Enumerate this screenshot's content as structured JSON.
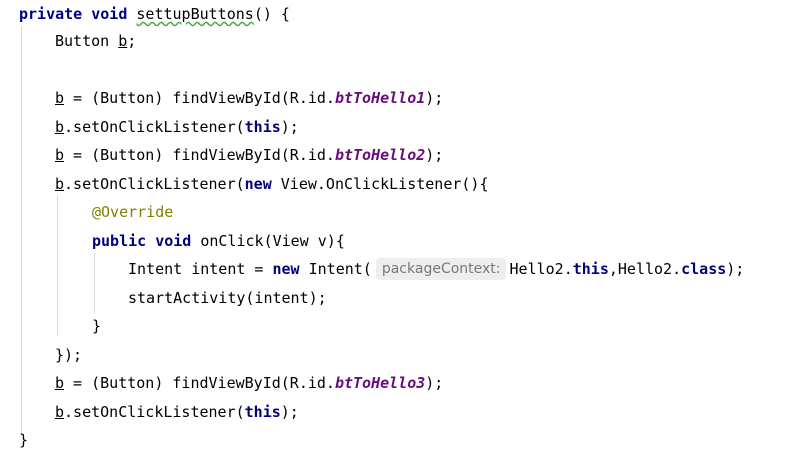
{
  "code": {
    "l1": {
      "kw_private": "private",
      "kw_void": "void",
      "method": "settupButtons",
      "rest": "() {"
    },
    "l2": {
      "type": "Button",
      "var": "b",
      "semi": ";"
    },
    "l4": {
      "var": "b",
      "assign": " = (Button) findViewById(R.id.",
      "field": "btToHello1",
      "end": ");"
    },
    "l5": {
      "var": "b",
      "call": ".setOnClickListener(",
      "kw_this": "this",
      "end": ");"
    },
    "l6": {
      "var": "b",
      "assign": " = (Button) findViewById(R.id.",
      "field": "btToHello2",
      "end": ");"
    },
    "l7": {
      "var": "b",
      "call": ".setOnClickListener(",
      "kw_new": "new",
      "rest": " View.OnClickListener(){"
    },
    "l8": {
      "annotation": "@Override"
    },
    "l9": {
      "kw_public": "public",
      "kw_void": "void",
      "rest": " onClick(View v){"
    },
    "l10": {
      "pre": "Intent intent = ",
      "kw_new": "new",
      "mid": " Intent(",
      "hint": "packageContext:",
      "arg1": "Hello2.",
      "kw_this": "this",
      "arg2": ",Hello2.",
      "kw_class": "class",
      "end": ");"
    },
    "l11": {
      "text": "startActivity(intent);"
    },
    "l12": {
      "text": "}"
    },
    "l13": {
      "text": "});"
    },
    "l14": {
      "var": "b",
      "assign": " = (Button) findViewById(R.id.",
      "field": "btToHello3",
      "end": ");"
    },
    "l15": {
      "var": "b",
      "call": ".setOnClickListener(",
      "kw_this": "this",
      "end": ");"
    },
    "l16": {
      "text": "}"
    }
  },
  "colors": {
    "keyword": "#000080",
    "field": "#660e7a",
    "annotation": "#808000",
    "hint_bg": "#eeeeee",
    "hint_text": "#787878",
    "indent_guide": "#d9d9d9"
  }
}
